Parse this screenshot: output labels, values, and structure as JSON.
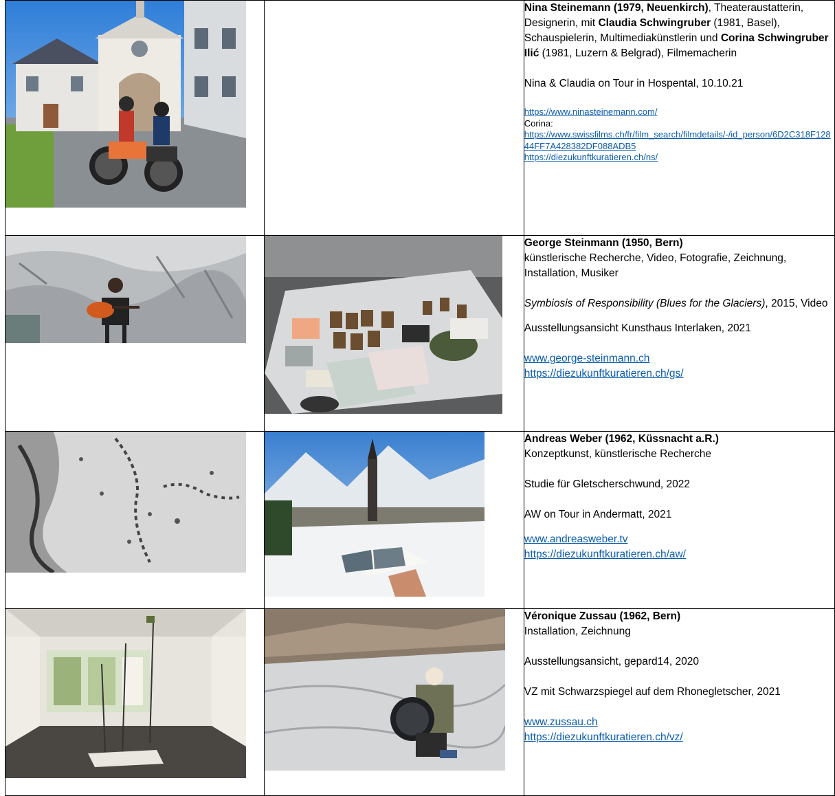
{
  "rows": [
    {
      "name_title": "Nina Steinemann (1979, Neuenkirch)",
      "after_name": ",",
      "roles_1": "Theateraustatterin, Designerin, mit ",
      "partner1_name": "Claudia Schwingruber",
      "partner1_info": " (1981, Basel), Schauspielerin, Multimediakünstlerin und ",
      "partner2_name": "Corina Schwingruber Ilić",
      "partner2_info": " (1981, Luzern & Belgrad), Filmemacherin",
      "caption": "Nina & Claudia on Tour in Hospental, 10.10.21",
      "link1": "https://www.ninasteinemann.com/",
      "corina_label": "Corina:",
      "link2": "https://www.swissfilms.ch/fr/film_search/filmdetails/-/id_person/6D2C318F12844FF7A428382DF088ADB5",
      "link3": "https://diezukunftkuratieren.ch/ns/"
    },
    {
      "name_title": "George Steinmann (1950, Bern)",
      "roles": "künstlerische Recherche, Video, Fotografie, Zeichnung, Installation, Musiker",
      "work_title": "Symbiosis of Responsibility (Blues for the Glaciers)",
      "work_info": ", 2015, Video",
      "caption": "Ausstellungsansicht Kunsthaus Interlaken, 2021",
      "link1": "www.george-steinmann.ch",
      "link2": "https://diezukunftkuratieren.ch/gs/"
    },
    {
      "name_title": "Andreas Weber (1962, Küssnacht a.R.)",
      "roles": "Konzeptkunst, künstlerische Recherche",
      "work": "Studie für Gletscherschwund, 2022",
      "caption": "AW on Tour in Andermatt, 2021",
      "link1": "www.andreasweber.tv",
      "link2": "https://diezukunftkuratieren.ch/aw/"
    },
    {
      "name_title": "Véronique Zussau (1962, Bern)",
      "roles": "Installation, Zeichnung",
      "work": "Ausstellungsansicht, gepard14, 2020",
      "caption": "VZ mit Schwarzspiegel auf dem Rhonegletscher, 2021",
      "link1": "www.zussau.ch",
      "link2": "https://diezukunftkuratieren.ch/vz/"
    }
  ]
}
